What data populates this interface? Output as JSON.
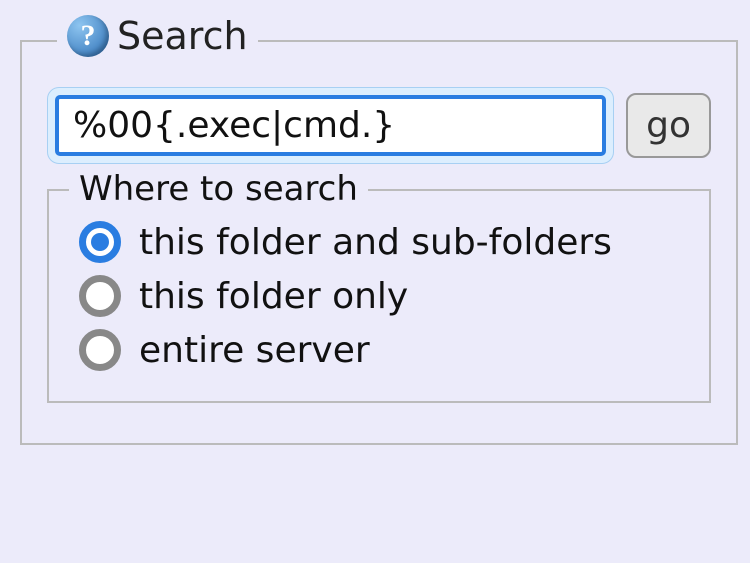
{
  "search": {
    "legend": "Search",
    "query_value": "%00{.exec|cmd.}",
    "go_label": "go"
  },
  "where": {
    "legend": "Where to search",
    "options": [
      {
        "label": "this folder and sub-folders",
        "selected": true
      },
      {
        "label": "this folder only",
        "selected": false
      },
      {
        "label": "entire server",
        "selected": false
      }
    ]
  }
}
